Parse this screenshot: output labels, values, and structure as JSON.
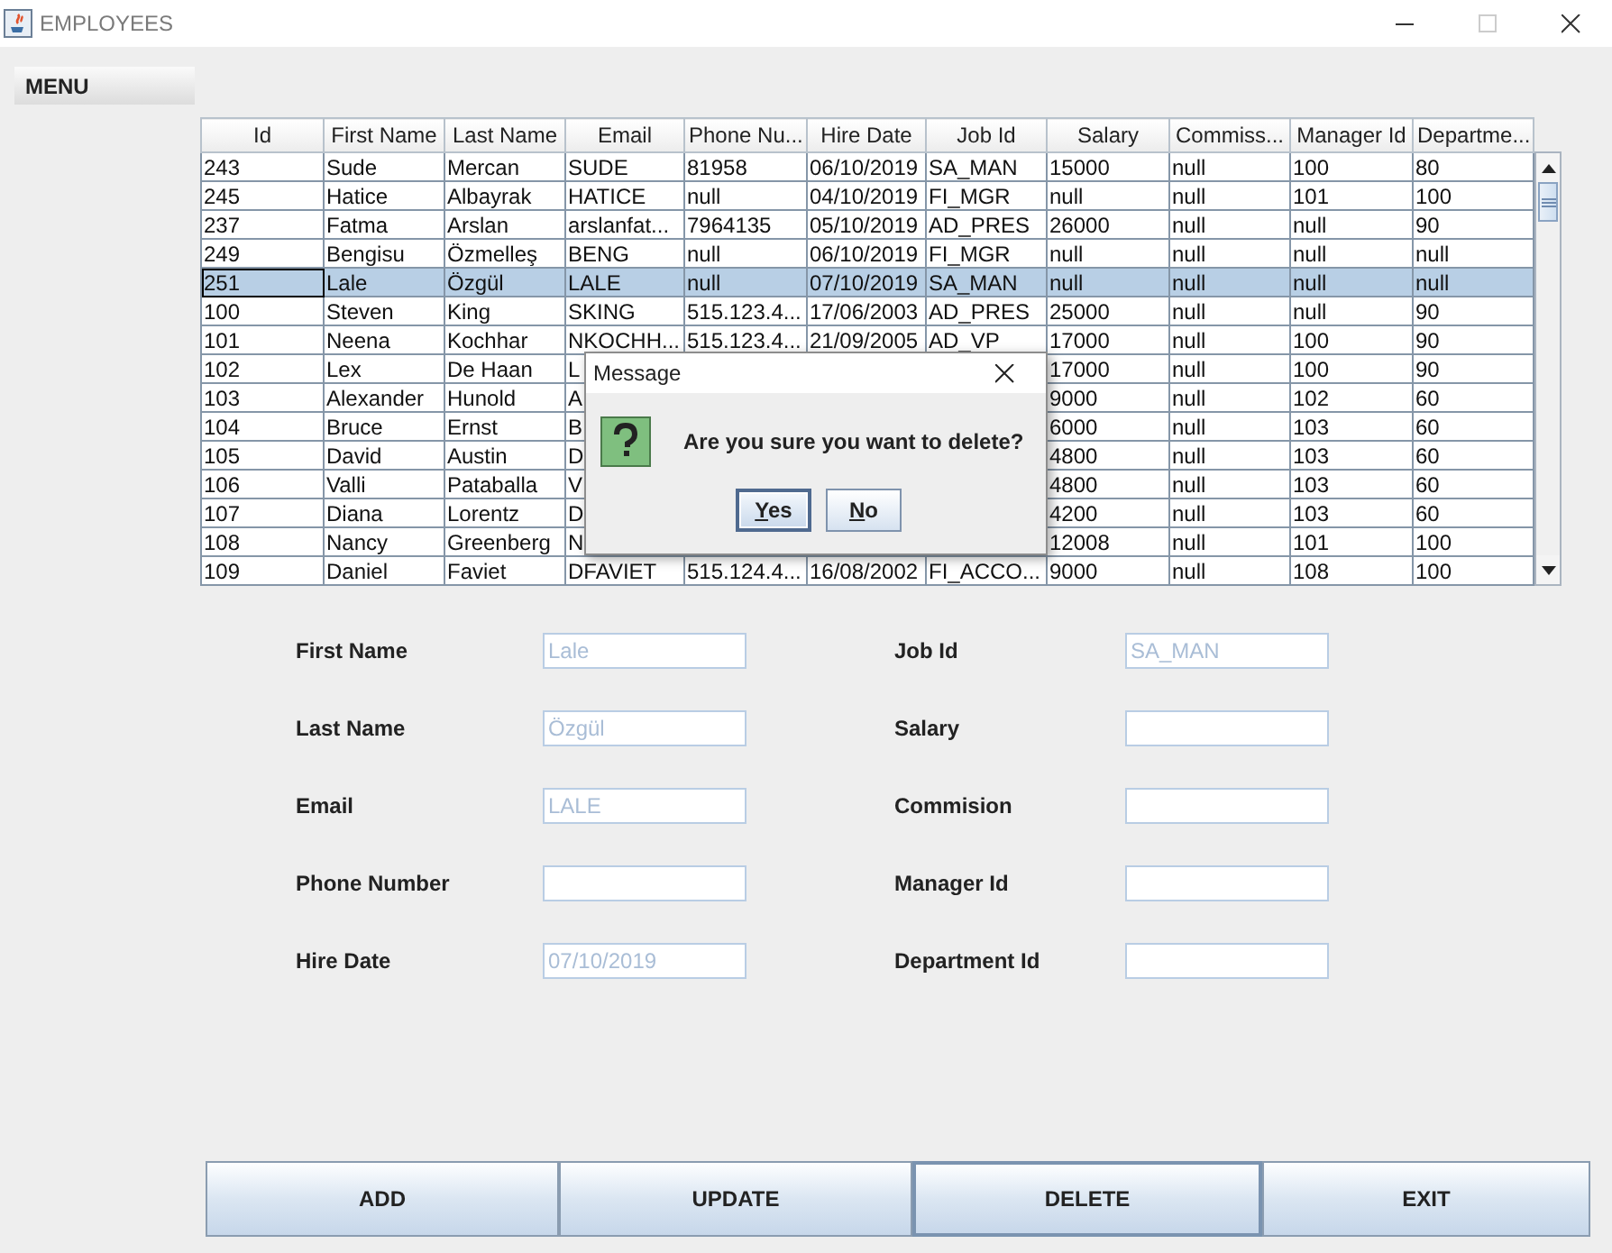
{
  "window": {
    "title": "EMPLOYEES"
  },
  "menu": {
    "label": "MENU"
  },
  "table": {
    "columns": [
      "Id",
      "First Name",
      "Last Name",
      "Email",
      "Phone Nu...",
      "Hire Date",
      "Job Id",
      "Salary",
      "Commiss...",
      "Manager Id",
      "Departme..."
    ],
    "rows": [
      {
        "cells": [
          "243",
          "Sude",
          "Mercan",
          "SUDE",
          "81958",
          "06/10/2019",
          "SA_MAN",
          "15000",
          "null",
          "100",
          "80"
        ],
        "selected": false,
        "focused": false
      },
      {
        "cells": [
          "245",
          "Hatice",
          "Albayrak",
          "HATICE",
          "null",
          "04/10/2019",
          "FI_MGR",
          "null",
          "null",
          "101",
          "100"
        ],
        "selected": false,
        "focused": false
      },
      {
        "cells": [
          "237",
          "Fatma",
          "Arslan",
          "arslanfat...",
          "7964135",
          "05/10/2019",
          "AD_PRES",
          "26000",
          "null",
          "null",
          "90"
        ],
        "selected": false,
        "focused": false
      },
      {
        "cells": [
          "249",
          "Bengisu",
          "Özmelleş",
          "BENG",
          "null",
          "06/10/2019",
          "FI_MGR",
          "null",
          "null",
          "null",
          "null"
        ],
        "selected": false,
        "focused": false
      },
      {
        "cells": [
          "251",
          "Lale",
          "Özgül",
          "LALE",
          "null",
          "07/10/2019",
          "SA_MAN",
          "null",
          "null",
          "null",
          "null"
        ],
        "selected": true,
        "focused": true
      },
      {
        "cells": [
          "100",
          "Steven",
          "King",
          "SKING",
          "515.123.4...",
          "17/06/2003",
          "AD_PRES",
          "25000",
          "null",
          "null",
          "90"
        ],
        "selected": false,
        "focused": false
      },
      {
        "cells": [
          "101",
          "Neena",
          "Kochhar",
          "NKOCHH...",
          "515.123.4...",
          "21/09/2005",
          "AD_VP",
          "17000",
          "null",
          "100",
          "90"
        ],
        "selected": false,
        "focused": false
      },
      {
        "cells": [
          "102",
          "Lex",
          "De Haan",
          "L",
          null,
          null,
          null,
          "17000",
          "null",
          "100",
          "90"
        ],
        "selected": false,
        "focused": false
      },
      {
        "cells": [
          "103",
          "Alexander",
          "Hunold",
          "A",
          null,
          null,
          null,
          "9000",
          "null",
          "102",
          "60"
        ],
        "selected": false,
        "focused": false
      },
      {
        "cells": [
          "104",
          "Bruce",
          "Ernst",
          "B",
          null,
          null,
          null,
          "6000",
          "null",
          "103",
          "60"
        ],
        "selected": false,
        "focused": false
      },
      {
        "cells": [
          "105",
          "David",
          "Austin",
          "D",
          null,
          null,
          null,
          "4800",
          "null",
          "103",
          "60"
        ],
        "selected": false,
        "focused": false
      },
      {
        "cells": [
          "106",
          "Valli",
          "Pataballa",
          "V",
          null,
          null,
          null,
          "4800",
          "null",
          "103",
          "60"
        ],
        "selected": false,
        "focused": false
      },
      {
        "cells": [
          "107",
          "Diana",
          "Lorentz",
          "D",
          null,
          null,
          null,
          "4200",
          "null",
          "103",
          "60"
        ],
        "selected": false,
        "focused": false
      },
      {
        "cells": [
          "108",
          "Nancy",
          "Greenberg",
          "N",
          null,
          null,
          null,
          "12008",
          "null",
          "101",
          "100"
        ],
        "selected": false,
        "focused": false
      },
      {
        "cells": [
          "109",
          "Daniel",
          "Faviet",
          "DFAVIET",
          "515.124.4...",
          "16/08/2002",
          "FI_ACCO...",
          "9000",
          "null",
          "108",
          "100"
        ],
        "selected": false,
        "focused": false
      }
    ]
  },
  "form": {
    "left_fields": [
      {
        "label": "First Name",
        "value": "Lale"
      },
      {
        "label": "Last Name",
        "value": "Özgül"
      },
      {
        "label": "Email",
        "value": "LALE"
      },
      {
        "label": "Phone Number"
      },
      {
        "label": "Hire Date",
        "value": "07/10/2019"
      }
    ],
    "right_fields": [
      {
        "label": "Job Id",
        "value": "SA_MAN"
      },
      {
        "label": "Salary"
      },
      {
        "label": "Commision"
      },
      {
        "label": "Manager Id"
      },
      {
        "label": "Department Id"
      }
    ]
  },
  "buttons": [
    {
      "label": "ADD",
      "focused": false
    },
    {
      "label": "UPDATE",
      "focused": false
    },
    {
      "label": "DELETE",
      "focused": true
    },
    {
      "label": "EXIT",
      "focused": false
    }
  ],
  "dialog": {
    "title": "Message",
    "message": "Are you sure you want to delete?",
    "buttons": [
      {
        "label": "Yes",
        "focused": true,
        "mnemonic": true
      },
      {
        "label": "No",
        "focused": false,
        "mnemonic": true
      }
    ]
  }
}
